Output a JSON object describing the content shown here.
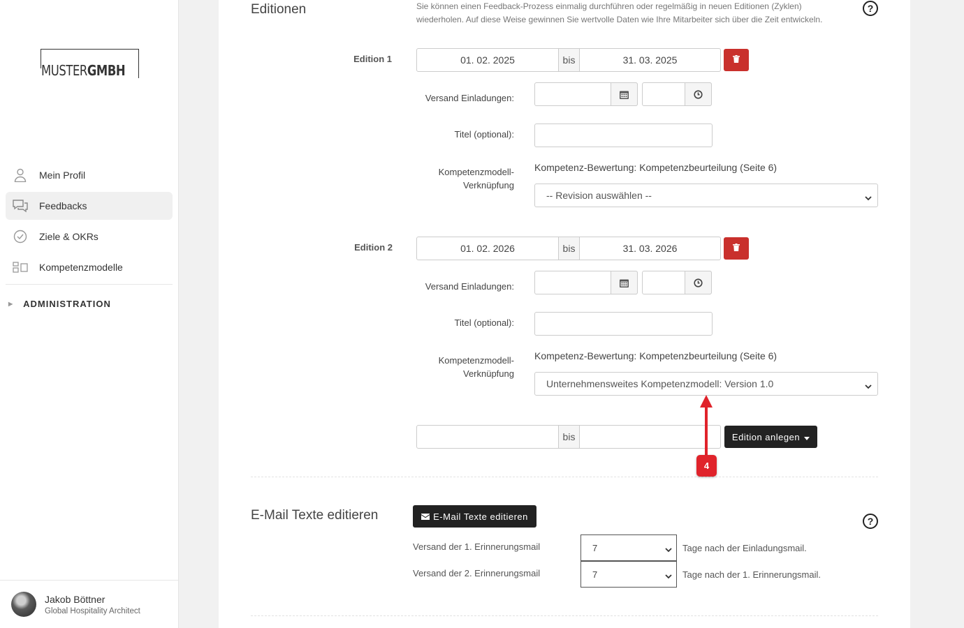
{
  "sidebar": {
    "logo": {
      "part1": "MUSTER",
      "part2": "GMBH"
    },
    "nav": [
      {
        "label": "Mein Profil",
        "icon": "user-icon"
      },
      {
        "label": "Feedbacks",
        "icon": "chat-icon"
      },
      {
        "label": "Ziele & OKRs",
        "icon": "check-circle-icon"
      },
      {
        "label": "Kompetenzmodelle",
        "icon": "modules-icon"
      }
    ],
    "admin": "ADMINISTRATION",
    "user": {
      "name": "Jakob Böttner",
      "role": "Global Hospitality Architect"
    }
  },
  "editions": {
    "title": "Editionen",
    "description": "Sie können einen Feedback-Prozess einmalig durchführen oder regelmäßig in neuen Editionen (Zyklen) wiederholen. Auf diese Weise gewinnen Sie wertvolle Daten wie Ihre Mitarbeiter sich über die Zeit entwickeln.",
    "bis": "bis",
    "labels": {
      "versand": "Versand Einladungen:",
      "titel": "Titel (optional):",
      "kompetenz1": "Kompetenzmodell-",
      "kompetenz2": "Verknüpfung"
    },
    "items": [
      {
        "label": "Edition 1",
        "from": "01. 02. 2025",
        "to": "31. 03. 2025",
        "kb_title": "Kompetenz-Bewertung: Kompetenzbeurteilung (Seite 6)",
        "select": "-- Revision auswählen --"
      },
      {
        "label": "Edition 2",
        "from": "01. 02. 2026",
        "to": "31. 03. 2026",
        "kb_title": "Kompetenz-Bewertung: Kompetenzbeurteilung (Seite 6)",
        "select": "Unternehmensweites Kompetenzmodell: Version 1.0"
      }
    ],
    "new_button": "Edition anlegen",
    "marker": "4"
  },
  "email": {
    "title": "E-Mail Texte editieren",
    "button": "E-Mail Texte editieren",
    "reminder1_label": "Versand der 1. Erinnerungsmail",
    "reminder1_value": "7",
    "reminder1_suffix": "Tage nach der Einladungsmail.",
    "reminder2_label": "Versand der 2. Erinnerungsmail",
    "reminder2_value": "7",
    "reminder2_suffix": "Tage nach der 1. Erinnerungsmail."
  },
  "colors": {
    "danger": "#c9302c",
    "marker": "#e0232b",
    "dark": "#222222"
  }
}
